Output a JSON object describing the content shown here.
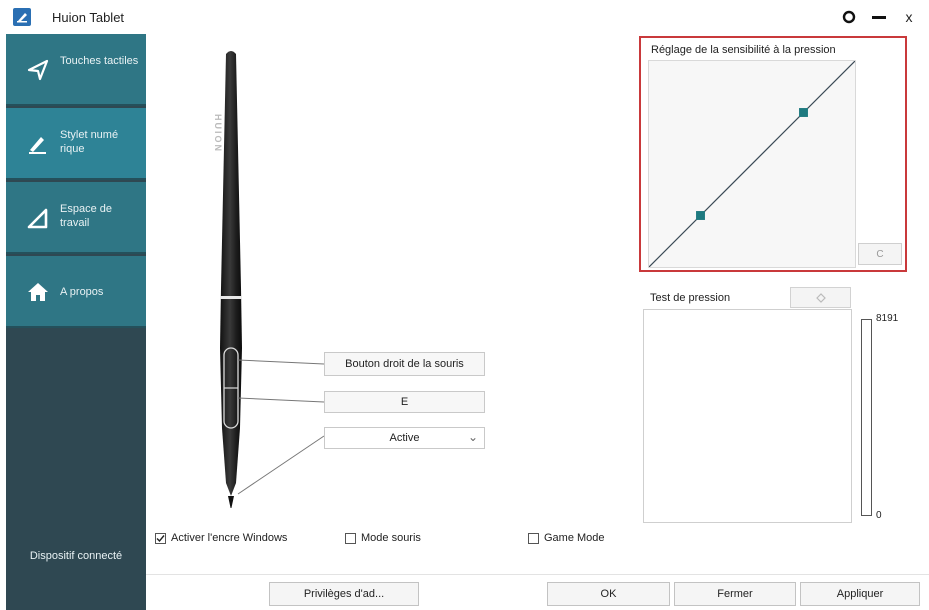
{
  "window": {
    "title": "Huion Tablet",
    "close_glyph": "x"
  },
  "sidebar": {
    "items": [
      {
        "label": "Touches tactiles",
        "icon": "send-icon"
      },
      {
        "label": "Stylet numé rique",
        "icon": "pen-icon"
      },
      {
        "label": "Espace de travail",
        "icon": "workspace-icon"
      },
      {
        "label": "A propos",
        "icon": "home-icon"
      }
    ],
    "status": "Dispositif connecté"
  },
  "pen": {
    "brand": "HUION",
    "upper_button": "Bouton droit de la souris",
    "lower_button": "E",
    "tip_mode": "Active"
  },
  "pressure": {
    "title": "Réglage de la sensibilité à la pression",
    "reset_label": "C",
    "control_points": [
      [
        0.25,
        0.25
      ],
      [
        0.75,
        0.75
      ]
    ]
  },
  "pressure_test": {
    "title": "Test de pression",
    "max": "8191",
    "min": "0",
    "level": 0
  },
  "options": {
    "windows_ink": {
      "label": "Activer l'encre Windows",
      "checked": true
    },
    "mouse_mode": {
      "label": "Mode souris",
      "checked": false
    },
    "game_mode": {
      "label": "Game Mode",
      "checked": false
    }
  },
  "footer": {
    "privileges": "Privilèges d'ad...",
    "ok": "OK",
    "close": "Fermer",
    "apply": "Appliquer"
  },
  "colors": {
    "sidebar": "#2f4852",
    "sidebar_item": "#2f7685",
    "highlight": "#c9393b",
    "curve_point": "#1e7a80"
  }
}
